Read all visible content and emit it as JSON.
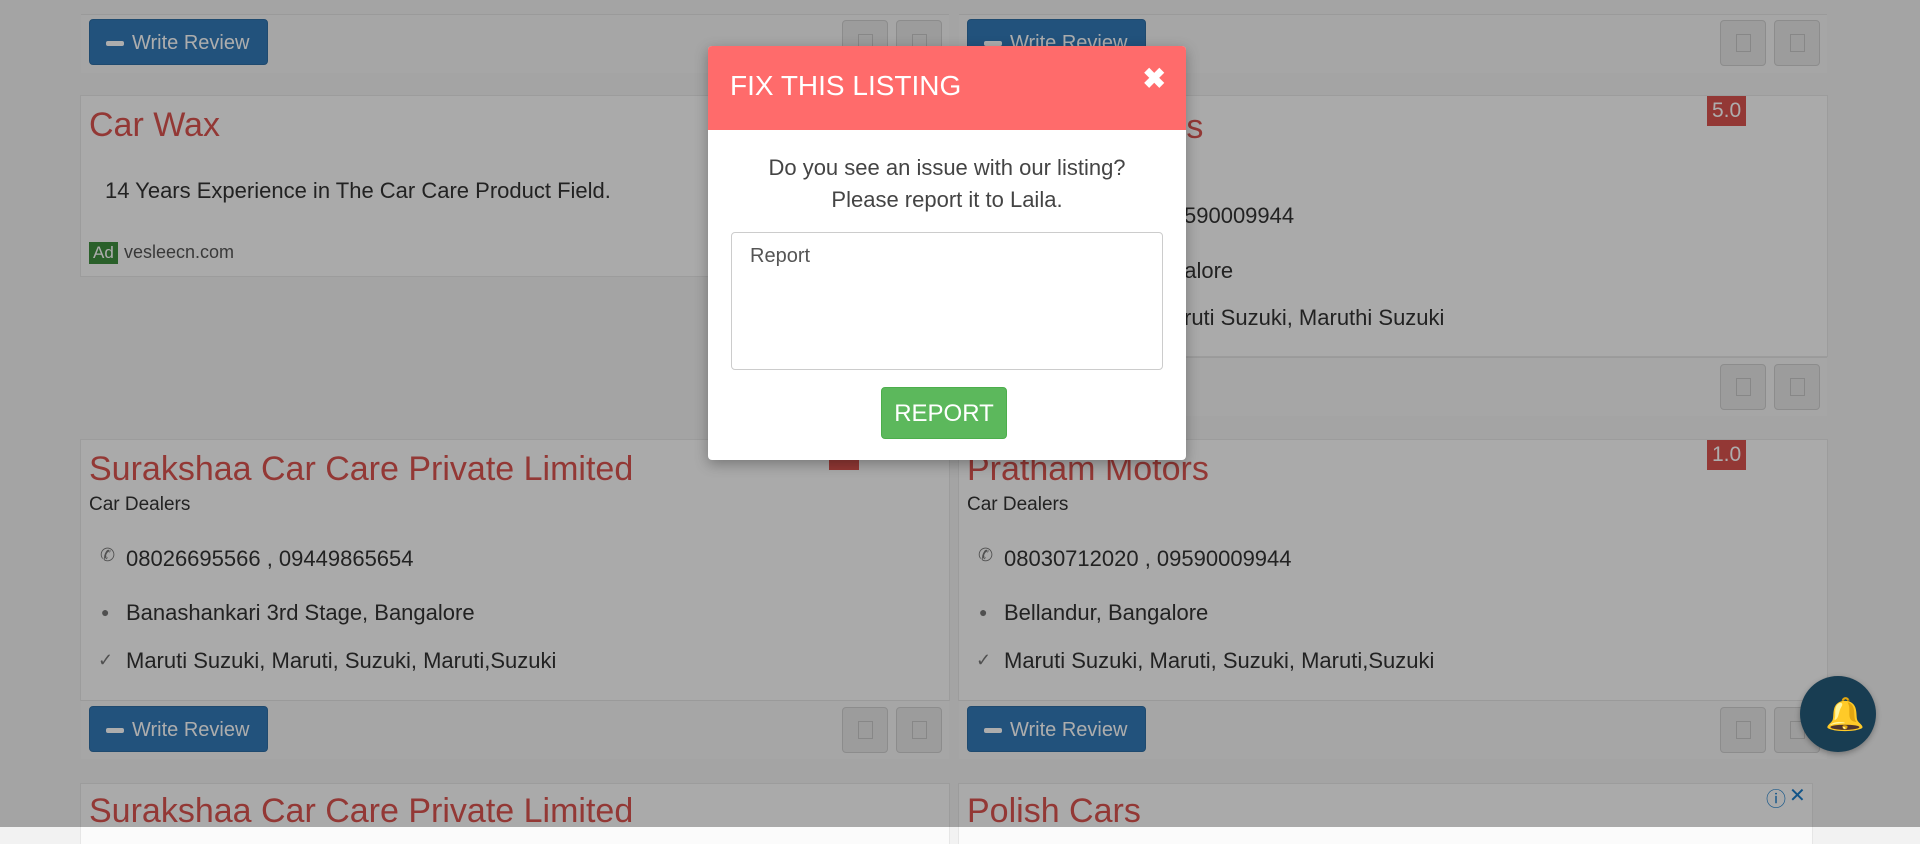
{
  "write_review_label": "Write Review",
  "ad_card": {
    "title": "Car Wax",
    "description": "14 Years Experience in The Car Care Product Field.",
    "ad_badge": "Ad",
    "domain": "vesleecn.com"
  },
  "top_right_card": {
    "title_fragment": "rs",
    "rating": "5.0",
    "phone_fragment": "590009944",
    "location_fragment": "galore",
    "brands_fragment": "ruti Suzuki, Maruthi Suzuki"
  },
  "listings": [
    {
      "title": "Surakshaa Car Care Private Limited",
      "category": "Car Dealers",
      "phone": "08026695566 , 09449865654",
      "location": "Banashankari 3rd Stage, Bangalore",
      "brands": "Maruti Suzuki, Maruti, Suzuki, Maruti,Suzuki"
    },
    {
      "title": "Pratham Motors",
      "rating": "1.0",
      "category": "Car Dealers",
      "phone": "08030712020 , 09590009944",
      "location": "Bellandur, Bangalore",
      "brands": "Maruti Suzuki, Maruti, Suzuki, Maruti,Suzuki"
    }
  ],
  "bottom_cards": [
    {
      "title": "Surakshaa Car Care Private Limited"
    },
    {
      "title": "Polish Cars"
    }
  ],
  "modal": {
    "title": "FIX THIS LISTING",
    "close_icon": "✖",
    "message_line1": "Do you see an issue with our listing?",
    "message_line2": "Please report it to Laila.",
    "report_placeholder": "Report",
    "submit_label": "REPORT"
  },
  "icons": {
    "phone": "✆",
    "location": "●",
    "check": "✓",
    "bell": "🔔",
    "ad_info": "ⓘ",
    "ad_close": "✕"
  },
  "colors": {
    "modal_header": "#ff6b6b",
    "title_red": "#d9534f",
    "primary_blue": "#337ab7",
    "success_green": "#5cb85c",
    "bell_bg": "#183d52"
  }
}
